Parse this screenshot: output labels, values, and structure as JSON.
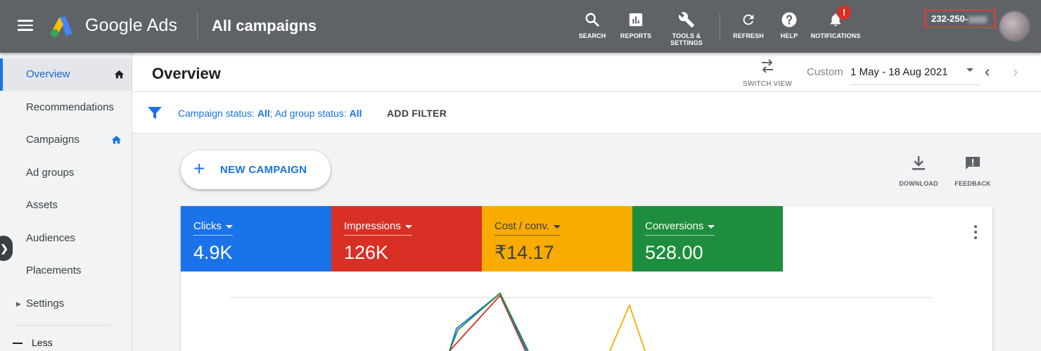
{
  "topbar": {
    "brand": "Google Ads",
    "page_context": "All campaigns",
    "buttons": [
      {
        "label": "SEARCH",
        "icon": "search-icon"
      },
      {
        "label": "REPORTS",
        "icon": "reports-icon"
      },
      {
        "label": "TOOLS &",
        "label2": "SETTINGS",
        "icon": "wrench-icon"
      },
      {
        "label": "REFRESH",
        "icon": "refresh-icon"
      },
      {
        "label": "HELP",
        "icon": "help-icon"
      },
      {
        "label": "NOTIFICATIONS",
        "icon": "bell-icon",
        "badge": "!"
      }
    ],
    "account_id": "232-250-",
    "colors": {
      "bar": "#5f6368",
      "badge": "#d93025",
      "highlight_box": "#e53935"
    }
  },
  "sidebar": {
    "items": [
      {
        "label": "Overview",
        "active": true,
        "home": true
      },
      {
        "label": "Recommendations"
      },
      {
        "label": "Campaigns",
        "home": true
      },
      {
        "label": "Ad groups"
      },
      {
        "label": "Assets"
      },
      {
        "label": "Audiences"
      },
      {
        "label": "Placements"
      },
      {
        "label": "Settings",
        "expandable": true
      }
    ],
    "less_label": "Less",
    "expand_icon": "chevron-right-icon"
  },
  "header": {
    "title": "Overview",
    "switch_view_label": "SWITCH VIEW",
    "date_range_label": "Custom",
    "date_range_value": "1 May - 18 Aug 2021"
  },
  "filters": {
    "campaign_status_label": "Campaign status:",
    "campaign_status_value": "All",
    "ad_group_status_label": "Ad group status:",
    "ad_group_status_value": "All",
    "add_filter_label": "ADD FILTER"
  },
  "actions": {
    "new_campaign_label": "NEW CAMPAIGN",
    "download_label": "DOWNLOAD",
    "feedback_label": "FEEDBACK"
  },
  "metrics": [
    {
      "name": "Clicks",
      "value": "4.9K",
      "color": "#1a73e8"
    },
    {
      "name": "Impressions",
      "value": "126K",
      "color": "#d93025"
    },
    {
      "name": "Cost / conv.",
      "value": "₹14.17",
      "color": "#f9ab00"
    },
    {
      "name": "Conversions",
      "value": "528.00",
      "color": "#1e8e3e"
    }
  ]
}
